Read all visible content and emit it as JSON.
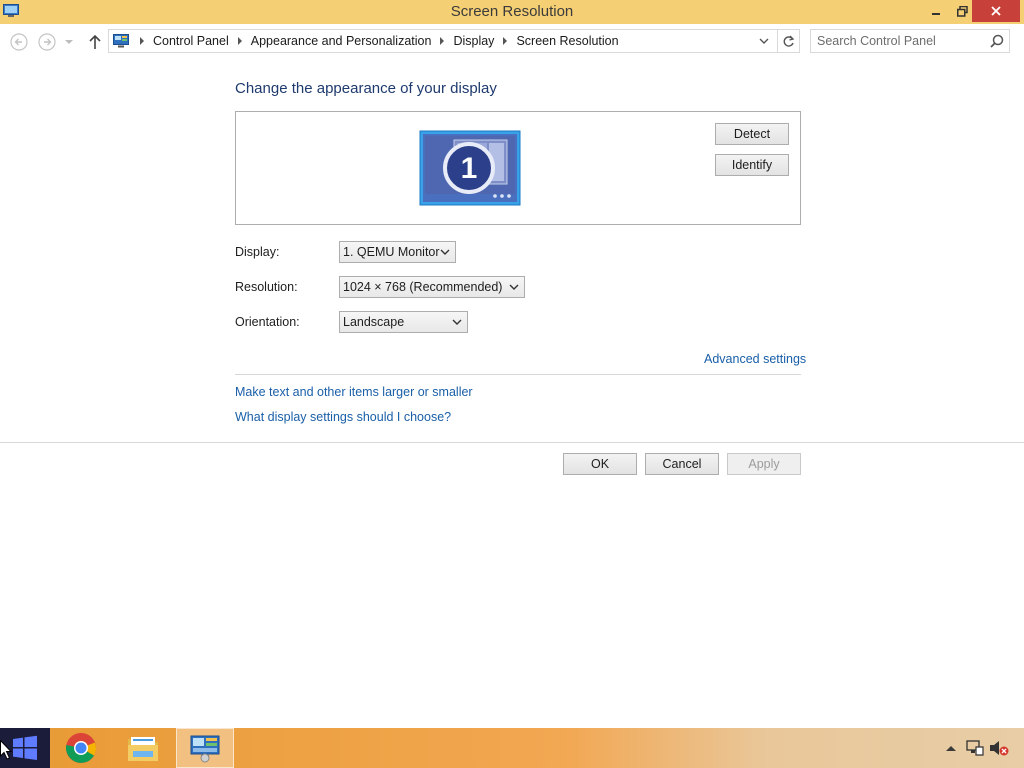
{
  "window": {
    "title": "Screen Resolution"
  },
  "nav": {
    "breadcrumbs": [
      "Control Panel",
      "Appearance and Personalization",
      "Display",
      "Screen Resolution"
    ],
    "search_placeholder": "Search Control Panel"
  },
  "main": {
    "heading": "Change the appearance of your display",
    "monitor_number": "1",
    "detect_label": "Detect",
    "identify_label": "Identify",
    "display_label": "Display:",
    "display_value": "1. QEMU Monitor",
    "resolution_label": "Resolution:",
    "resolution_value": "1024 × 768 (Recommended)",
    "orientation_label": "Orientation:",
    "orientation_value": "Landscape",
    "advanced_link": "Advanced settings",
    "text_size_link": "Make text and other items larger or smaller",
    "help_link": "What display settings should I choose?"
  },
  "buttons": {
    "ok": "OK",
    "cancel": "Cancel",
    "apply": "Apply"
  },
  "taskbar": {
    "items": [
      "windows-start",
      "chrome",
      "file-explorer",
      "control-panel-screen-resolution"
    ]
  },
  "colors": {
    "titlebar": "#f4cf73",
    "close_button": "#c7413a",
    "link": "#1a5fa8",
    "heading": "#1e3a6e",
    "monitor_blue": "#4a6fbf"
  }
}
